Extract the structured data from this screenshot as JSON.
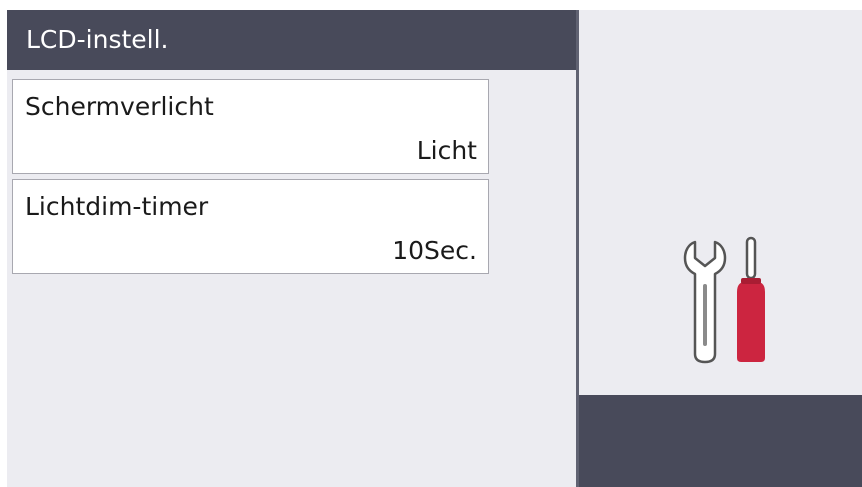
{
  "header": {
    "title": "LCD-instell."
  },
  "menu": {
    "items": [
      {
        "label": "Schermverlicht",
        "value": "Licht"
      },
      {
        "label": "Lichtdim-timer",
        "value": "10Sec."
      }
    ]
  },
  "icon": {
    "name": "tools-icon"
  },
  "colors": {
    "header_bg": "#484a5a",
    "screen_bg": "#ececf1",
    "screwdriver": "#cc2540"
  }
}
